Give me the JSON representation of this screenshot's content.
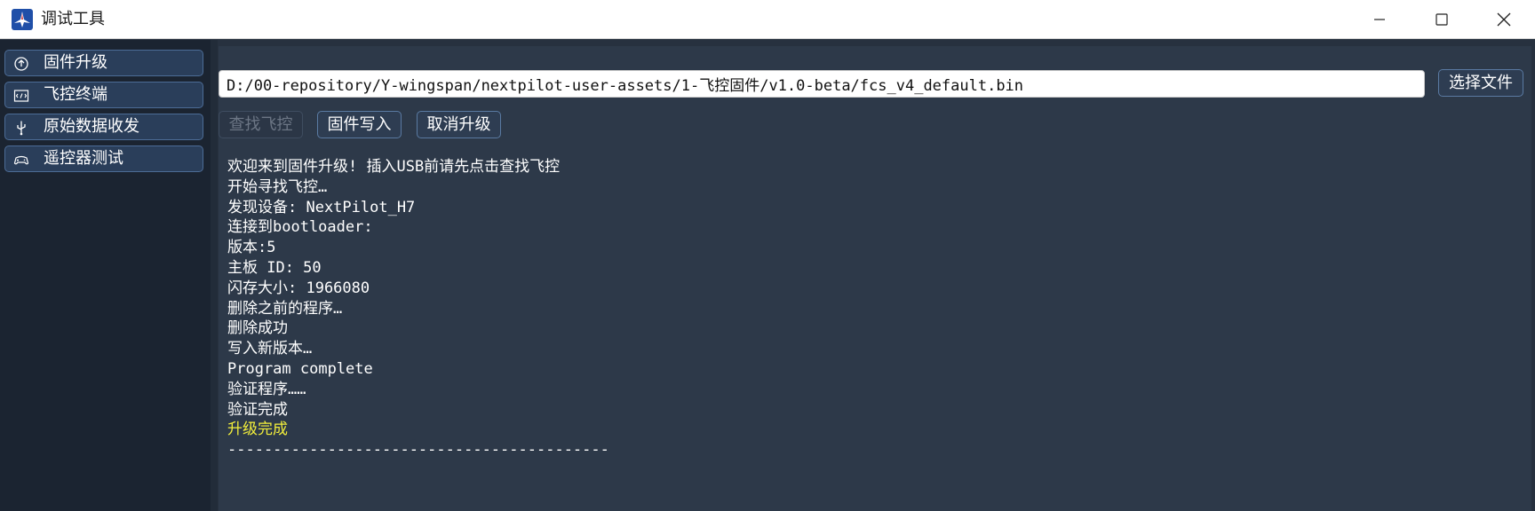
{
  "window": {
    "title": "调试工具",
    "controls": {
      "minimize": "minimize",
      "maximize": "maximize",
      "close": "close"
    }
  },
  "sidebar": {
    "items": [
      {
        "label": "固件升级",
        "icon": "firmware-upgrade-icon"
      },
      {
        "label": "飞控终端",
        "icon": "terminal-icon"
      },
      {
        "label": "原始数据收发",
        "icon": "usb-icon"
      },
      {
        "label": "遥控器测试",
        "icon": "gamepad-icon"
      }
    ]
  },
  "main": {
    "file_path": "D:/00-repository/Y-wingspan/nextpilot-user-assets/1-飞控固件/v1.0-beta/fcs_v4_default.bin",
    "choose_file_label": "选择文件",
    "find_label": "查找飞控",
    "write_label": "固件写入",
    "cancel_label": "取消升级",
    "log": [
      "欢迎来到固件升级! 插入USB前请先点击查找飞控",
      "开始寻找飞控…",
      "发现设备: NextPilot_H7",
      "连接到bootloader:",
      "版本:5",
      "主板 ID: 50",
      "闪存大小: 1966080",
      "删除之前的程序…",
      "删除成功",
      "写入新版本…",
      "Program complete",
      "验证程序……",
      "验证完成",
      "升级完成",
      "------------------------------------------"
    ],
    "highlight_color": "#f2ee3b"
  }
}
